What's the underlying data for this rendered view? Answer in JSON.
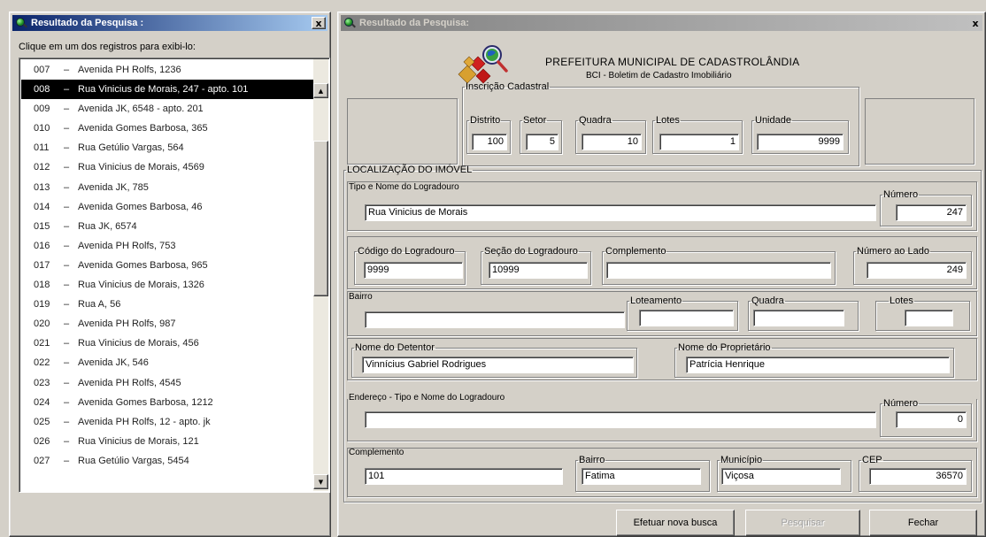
{
  "left_window": {
    "title": "Resultado da Pesquisa :",
    "close_label": "x",
    "instruction": "Clique em um dos registros para exibi-lo:",
    "separator": "–",
    "items": [
      {
        "code": "007",
        "address": "Avenida PH Rolfs, 1236"
      },
      {
        "code": "008",
        "address": "Rua Vinicius de Morais, 247 - apto. 101",
        "selected": true
      },
      {
        "code": "009",
        "address": "Avenida JK, 6548 - apto. 201"
      },
      {
        "code": "010",
        "address": "Avenida Gomes Barbosa, 365"
      },
      {
        "code": "011",
        "address": "Rua Getúlio Vargas, 564"
      },
      {
        "code": "012",
        "address": "Rua Vinicius de Morais, 4569"
      },
      {
        "code": "013",
        "address": "Avenida JK, 785"
      },
      {
        "code": "014",
        "address": "Avenida Gomes Barbosa, 46"
      },
      {
        "code": "015",
        "address": "Rua JK, 6574"
      },
      {
        "code": "016",
        "address": "Avenida PH Rolfs, 753"
      },
      {
        "code": "017",
        "address": "Avenida Gomes Barbosa, 965"
      },
      {
        "code": "018",
        "address": "Rua Vinicius de Morais, 1326"
      },
      {
        "code": "019",
        "address": "Rua A, 56"
      },
      {
        "code": "020",
        "address": "Avenida PH Rolfs, 987"
      },
      {
        "code": "021",
        "address": "Rua Vinicius de Morais, 456"
      },
      {
        "code": "022",
        "address": "Avenida JK, 546"
      },
      {
        "code": "023",
        "address": "Avenida PH Rolfs, 4545"
      },
      {
        "code": "024",
        "address": "Avenida Gomes Barbosa, 1212"
      },
      {
        "code": "025",
        "address": "Avenida PH Rolfs, 12 - apto. jk"
      },
      {
        "code": "026",
        "address": "Rua Vinicius de Morais, 121"
      },
      {
        "code": "027",
        "address": "Rua Getúlio Vargas, 5454"
      }
    ]
  },
  "right_window": {
    "title": "Resultado da Pesquisa:",
    "close_label": "x",
    "header": {
      "title": "PREFEITURA MUNICIPAL DE   CADASTROLÂNDIA",
      "subtitle": "BCI - Boletim de Cadastro Imobiliário"
    },
    "inscricao": {
      "legend": "Inscrição Cadastral",
      "distrito": {
        "label": "Distrito",
        "value": "100"
      },
      "setor": {
        "label": "Setor",
        "value": "5"
      },
      "quadra": {
        "label": "Quadra",
        "value": "10"
      },
      "lotes": {
        "label": "Lotes",
        "value": "1"
      },
      "unidade": {
        "label": "Unidade",
        "value": "9999"
      }
    },
    "localizacao": {
      "legend": "LOCALIZAÇÃO DO IMÓVEL",
      "tipo_nome": {
        "label": "Tipo e Nome do Logradouro",
        "value": "Rua Vinicius de Morais"
      },
      "numero": {
        "label": "Número",
        "value": "247"
      },
      "codigo": {
        "label": "Código do Logradouro",
        "value": "9999"
      },
      "secao": {
        "label": "Seção do Logradouro",
        "value": "10999"
      },
      "complemento": {
        "label": "Complemento",
        "value": ""
      },
      "numero_lado": {
        "label": "Número ao Lado",
        "value": "249"
      },
      "bairro": {
        "label": "Bairro",
        "value": ""
      },
      "loteamento": {
        "label": "Loteamento",
        "value": ""
      },
      "quadra": {
        "label": "Quadra",
        "value": ""
      },
      "lotes": {
        "label": "Lotes",
        "value": ""
      },
      "detentor": {
        "label": "Nome do Detentor",
        "value": "Vinnícius Gabriel Rodrigues"
      },
      "proprietario": {
        "label": "Nome do Proprietário",
        "value": "Patrícia Henrique"
      },
      "endereco": {
        "label": "Endereço - Tipo e Nome do Logradouro",
        "value": ""
      },
      "endereco_numero": {
        "label": "Número",
        "value": "0"
      },
      "end_complemento": {
        "label": "Complemento",
        "value": "101"
      },
      "end_bairro": {
        "label": "Bairro",
        "value": "Fatima"
      },
      "end_municipio": {
        "label": "Município",
        "value": "Viçosa"
      },
      "end_cep": {
        "label": "CEP",
        "value": "36570"
      }
    },
    "buttons": {
      "nova_busca": "Efetuar nova busca",
      "pesquisar": "Pesquisar",
      "fechar": "Fechar"
    }
  }
}
